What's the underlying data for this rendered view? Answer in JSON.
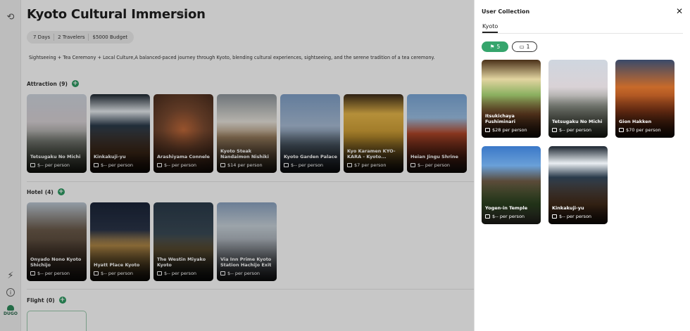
{
  "rail": {
    "undo_icon": "undo-icon",
    "expand_icon": "chevron-right-icon",
    "lightning_icon": "lightning-icon",
    "info_icon": "info-icon",
    "logo_text": "DUGO"
  },
  "trip": {
    "title": "Kyoto Cultural Immersion",
    "chips": [
      "7 Days",
      "2 Travelers",
      "$5000 Budget"
    ],
    "description": "Sightseeing + Tea Ceremony + Local Culture,A balanced-paced journey through Kyoto, blending cultural experiences, sightseeing, and the serene tradition of a tea ceremony."
  },
  "sections": {
    "attraction": {
      "label": "Attraction",
      "count": "(9)"
    },
    "hotel": {
      "label": "Hotel",
      "count": "(4)"
    },
    "flight": {
      "label": "Flight",
      "count": "(0)"
    }
  },
  "attractions": [
    {
      "name": "Tetsugaku No Michi",
      "price": "$-- per person",
      "bg": "linear-gradient(180deg,#cfd6df 0%,#d9d2d6 35%,#8a8f86 60%,#4a5040 100%)"
    },
    {
      "name": "Kinkakuji-yu",
      "price": "$-- per person",
      "bg": "linear-gradient(180deg,#1c2630 0%,#e9eef2 22%,#2a3a4a 40%,#5a3a22 75%,#2a1a10 100%)"
    },
    {
      "name": "Arashiyama Connele",
      "price": "$-- per person",
      "bg": "radial-gradient(circle at 50% 45%,#c26a3a 0%,#7a4a30 40%,#3a2418 100%)"
    },
    {
      "name": "Kyoto Steak Nandaimon Nishiki",
      "price": "$14 per person",
      "bg": "linear-gradient(180deg,#8e969c 0%,#e8e4dc 35%,#a88a68 55%,#4a3a2a 100%)"
    },
    {
      "name": "Kyoto Garden Palace",
      "price": "$-- per person",
      "bg": "linear-gradient(180deg,#7fa0c8 0%,#a9bdd6 40%,#5a6a7a 65%,#2a3038 100%)"
    },
    {
      "name": "Kyo Karamen KYO-KARA - Kyoto...",
      "price": "$7 per person",
      "bg": "linear-gradient(180deg,#3a2a18 0%,#e8b84a 25%,#c89830 55%,#2a2018 100%)"
    },
    {
      "name": "Heian Jingu Shrine",
      "price": "$-- per person",
      "bg": "linear-gradient(180deg,#7aa7d8 0%,#9cc0e4 30%,#b84a2a 50%,#6a2a1a 80%,#3a2a22 100%)"
    }
  ],
  "hotels": [
    {
      "name": "Onyado Nono Kyoto Shichijo",
      "price": "$-- per person",
      "bg": "linear-gradient(180deg,#bcc8d4 0%,#6a5a4a 35%,#4a3a2e 70%,#2a2420 100%)"
    },
    {
      "name": "Hyatt Place Kyoto",
      "price": "$-- per person",
      "bg": "linear-gradient(180deg,#1a2438 0%,#2a3448 35%,#c89a50 55%,#2a2418 100%)"
    },
    {
      "name": "The Westin Miyako Kyoto",
      "price": "$-- per person",
      "bg": "linear-gradient(180deg,#2a3a4a 0%,#3a4a56 40%,#6a5a3a 60%,#1a1e1e 100%)"
    },
    {
      "name": "Via Inn Prime Kyoto Station Hachijo Exit",
      "price": "$-- per person",
      "bg": "linear-gradient(180deg,#8aa2c0 0%,#c8d2da 30%,#9aa0a8 60%,#3a3e44 100%)"
    }
  ],
  "panel": {
    "title": "User Collection",
    "close_icon": "close-icon",
    "tab": "Kyoto",
    "filters": [
      {
        "icon": "flag-icon",
        "count": "5"
      },
      {
        "icon": "bed-icon",
        "count": "1"
      }
    ],
    "items": [
      {
        "name": "Itsukichaya Fushiminari",
        "price": "$28 per person",
        "bg": "linear-gradient(180deg,#4a3018 0%,#e2d4a0 25%,#8ab060 45%,#7a4a28 70%,#2a1a10 100%)"
      },
      {
        "name": "Tetsugaku No Michi",
        "price": "$-- per person",
        "bg": "linear-gradient(180deg,#cfd6df 0%,#d9d2d6 35%,#8a8f86 60%,#4a5040 100%)"
      },
      {
        "name": "Gion Hakken",
        "price": "$70 per person",
        "bg": "linear-gradient(180deg,#3a4a6a 0%,#c86a2a 35%,#8a3a18 65%,#2a140a 100%)"
      },
      {
        "name": "Yogen-in Temple",
        "price": "$-- per person",
        "bg": "linear-gradient(180deg,#3a78c8 0%,#6aa0d8 25%,#5a4a38 45%,#3a5a2a 75%,#6a6a5a 100%)"
      },
      {
        "name": "Kinkakuji-yu",
        "price": "$-- per person",
        "bg": "linear-gradient(180deg,#1c2630 0%,#e9eef2 22%,#2a3a4a 40%,#5a3a22 75%,#2a1a10 100%)"
      }
    ]
  }
}
